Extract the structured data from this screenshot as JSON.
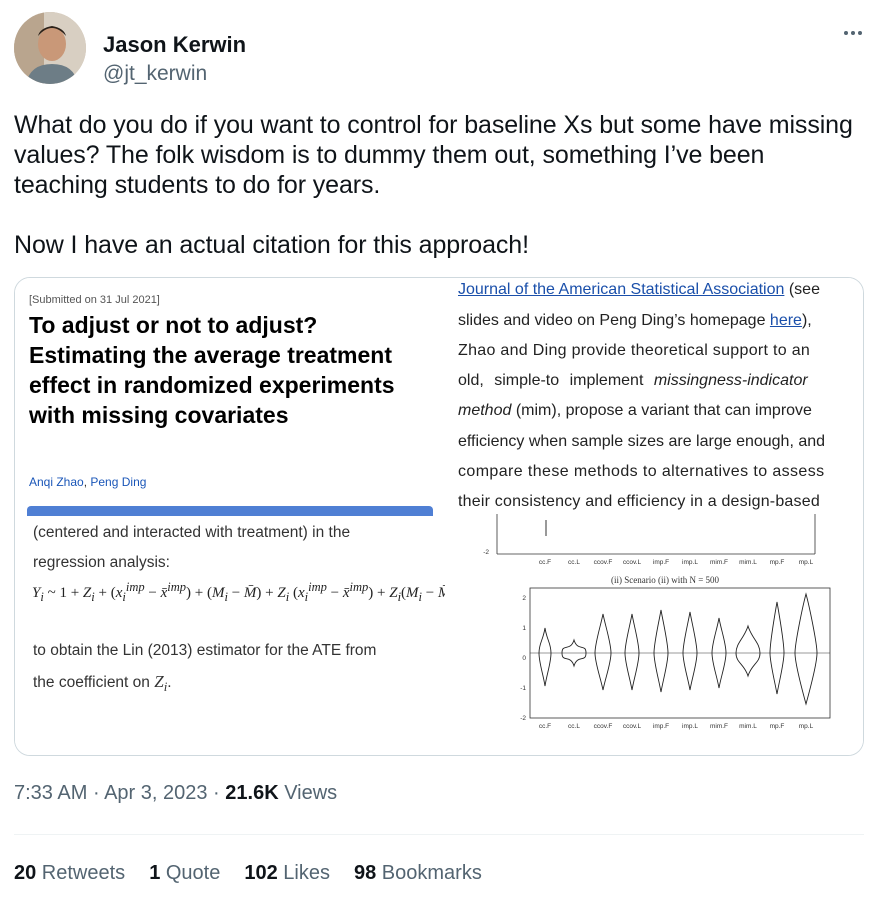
{
  "author": {
    "name": "Jason Kerwin",
    "handle": "@jt_kerwin"
  },
  "tweet": {
    "paragraph1": "What do you do if you want to control for baseline Xs but some have missing values? The folk wisdom is to dummy them out, something I’ve been teaching students to do for years.",
    "paragraph2": "Now I have an actual citation for this approach!"
  },
  "media": {
    "paper": {
      "submitted": "[Submitted on 31 Jul 2021]",
      "title": "To adjust or not to adjust? Estimating the average treatment effect in randomized experiments with missing covariates",
      "author1": "Anqi Zhao",
      "separator": ", ",
      "author2": "Peng Ding"
    },
    "excerpt": {
      "line1": "(centered and interacted with treatment) in the",
      "line2": "regression analysis:",
      "line3": "to obtain the Lin (2013) estimator for the ATE from",
      "line4_prefix": "the coefficient on ",
      "line4_var": "Z",
      "line4_sub": "i",
      "line4_suffix": "."
    },
    "journal_text": {
      "l1_link": "Journal of the American Statistical Association",
      "l1_rest": " (see",
      "l2_pre": "slides and video on Peng Ding’s homepage ",
      "l2_link": "here",
      "l2_post": "),",
      "l3": "Zhao and Ding provide theoretical support to an",
      "l4_pre": "old, simple-to implement ",
      "l4_ital": "missingness-indicator",
      "l5_ital": "method",
      "l5_post": " (mim), propose a variant that can improve",
      "l6": "efficiency when sample sizes are large enough, and",
      "l7": "compare these methods to alternatives to assess",
      "l8": "their consistency and efficiency in a design-based"
    },
    "plot": {
      "scenario_label": "(ii) Scenario (ii) with N = 500",
      "methods": [
        "cc.F",
        "cc.L",
        "ccov.F",
        "ccov.L",
        "imp.F",
        "imp.L",
        "mim.F",
        "mim.L",
        "mp.F",
        "mp.L"
      ],
      "y_ticks": [
        "2",
        "1",
        "0",
        "-1",
        "-2"
      ],
      "top_y_tick": "-2"
    }
  },
  "meta": {
    "time": "7:33 AM",
    "dot": " · ",
    "date": "Apr 3, 2023",
    "views_count": "21.6K",
    "views_label": " Views"
  },
  "stats": {
    "retweets_count": "20",
    "retweets_label": " Retweets",
    "quotes_count": "1",
    "quotes_label": " Quote",
    "likes_count": "102",
    "likes_label": " Likes",
    "bookmarks_count": "98",
    "bookmarks_label": " Bookmarks"
  }
}
